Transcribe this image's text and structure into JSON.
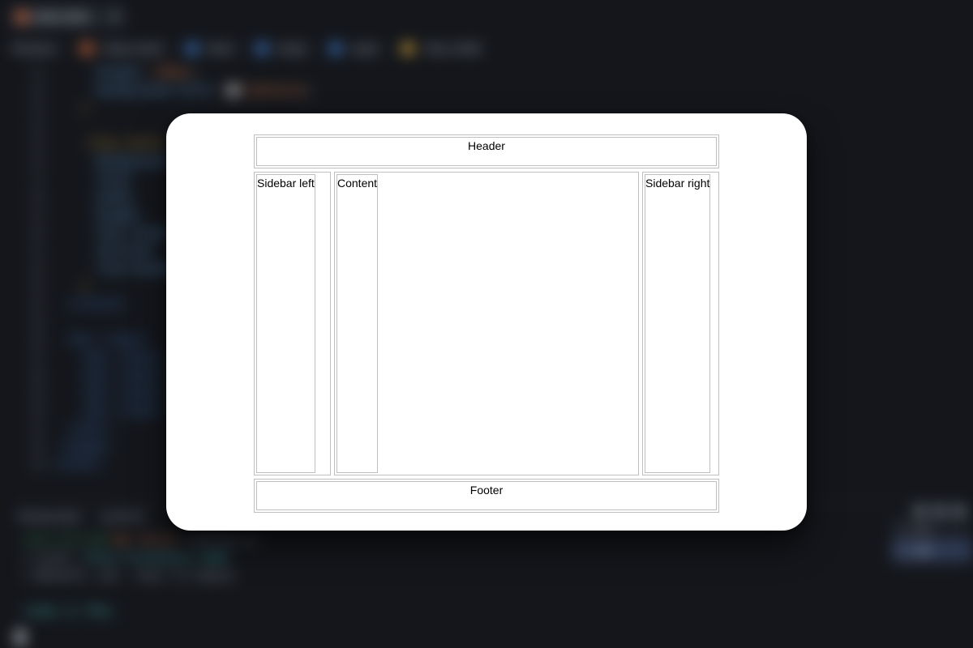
{
  "editor": {
    "tab_label": "index.html",
    "breadcrumbs": [
      "Flexbox",
      "index.html",
      "html",
      "body",
      "style",
      ".flex-child"
    ],
    "line_numbers": [
      "11",
      "12",
      "13",
      "14",
      "15",
      "16",
      "17",
      "18",
      "19",
      "20",
      "21",
      "22",
      "23",
      "24",
      "25",
      "26",
      "27",
      "28",
      "29",
      "30",
      "31",
      "32",
      "33"
    ],
    "code_lines": {
      "prop_height": "height",
      "val_200px": "200px",
      "prop_bg": "background-color",
      "val_lightgray": "lightgray",
      "sel_flexchild": ".flex-child",
      "prop_backgr": "background",
      "prop_color": "color",
      "prop_width": "width",
      "prop_height2": "height",
      "prop_textalign": "text-align",
      "prop_vertical": "vertical",
      "prop_lineheight": "line-height",
      "tag_style_close": "</style>",
      "tag_div_open": "<div class=",
      "tag_div_child": "<div class=",
      "tag_div_close": "</div>",
      "tag_body_close": "</body>",
      "tag_html_close": "</html>"
    },
    "terminal": {
      "tab_problems": "PROBLEMS",
      "tab_output": "OUTPUT",
      "line1_a": "vite v2.9.10",
      "line1_b": "dev server",
      "line1_c": "running at:",
      "line2_a": "Local:",
      "line2_b": "http://localhost:3000",
      "line3_a": "Network:",
      "line3_b": "use --host to expose",
      "line4": "ready in 75ms.",
      "shell1": "zsh",
      "shell2": "zsh"
    }
  },
  "preview": {
    "header": "Header",
    "sidebar_left": "Sidebar left",
    "content": "Content",
    "sidebar_right": "Sidebar right",
    "footer": "Footer"
  }
}
